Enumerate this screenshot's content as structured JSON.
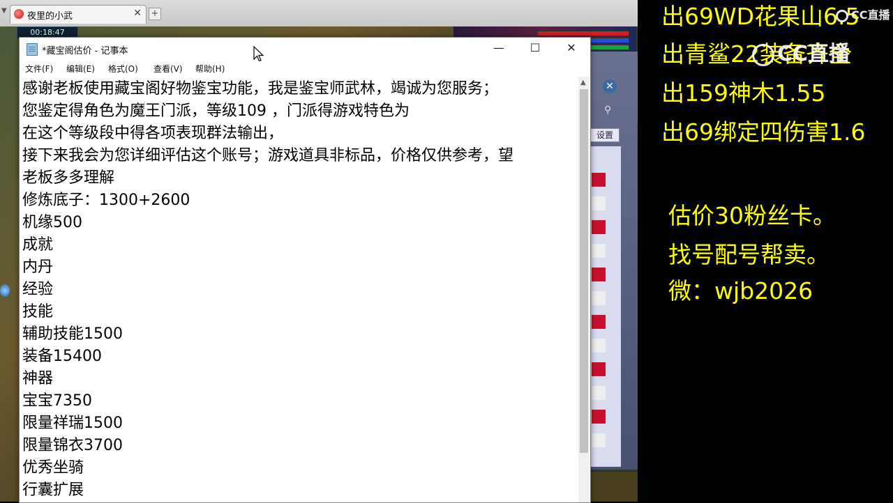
{
  "browser": {
    "tab_title": "夜里的小武",
    "tab_close": "✕",
    "new_tab": "+"
  },
  "game": {
    "timer": "00:18:47",
    "settings_label": "设置",
    "close_glyph": "✕"
  },
  "notepad": {
    "title": "*藏宝阁估价 - 记事本",
    "window_buttons": {
      "minimize": "—",
      "maximize": "☐",
      "close": "✕"
    },
    "menu": [
      "文件(F)",
      "编辑(E)",
      "格式(O)",
      "查看(V)",
      "帮助(H)"
    ],
    "lines": [
      "感谢老板使用藏宝阁好物鉴宝功能，我是鉴宝师武林，竭诚为您服务；",
      "您鉴定得角色为魔王门派，等级109 ，门派得游戏特色为",
      "在这个等级段中得各项表现群法输出，",
      "接下来我会为您详细评估这个账号；游戏道具非标品，价格仅供参考，望",
      "老板多多理解",
      "修炼底子：1300+2600",
      "机缘500",
      "成就",
      "内丹",
      "经验",
      "技能",
      "辅助技能1500",
      "装备15400",
      "神器",
      "宝宝7350",
      "限量祥瑞1500",
      "限量锦衣3700",
      "优秀坐骑",
      "行囊扩展"
    ]
  },
  "overlay": {
    "lines": [
      "出69WD花果山6.5",
      "出青鲨22装备齐全",
      "出159神木1.55",
      "出69绑定四伤害1.6",
      "估价30粉丝卡。",
      "找号配号帮卖。",
      "微：wjb2026"
    ],
    "text_color": "#ffff00"
  },
  "watermark": {
    "small": "CC直播",
    "large": "CC直播"
  }
}
